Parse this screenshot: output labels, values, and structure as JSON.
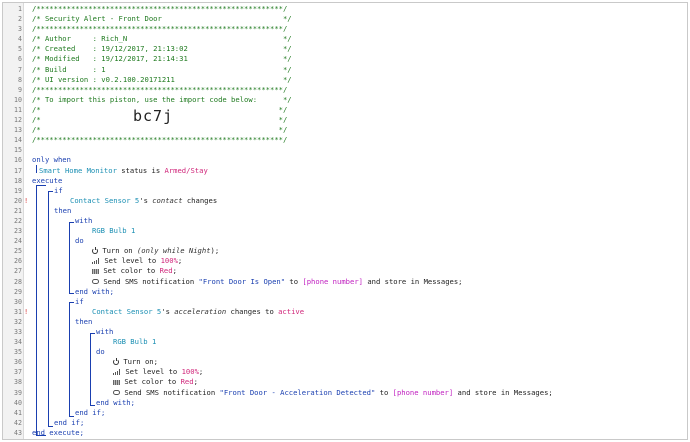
{
  "editor": {
    "lines": [
      {
        "n": "1",
        "t": "/*********************************************************/"
      },
      {
        "n": "2",
        "t": "/* Security Alert - Front Door                            */"
      },
      {
        "n": "3",
        "t": "/*********************************************************/"
      },
      {
        "n": "4",
        "t": "/* Author     : Rich_N                                    */"
      },
      {
        "n": "5",
        "t": "/* Created    : 19/12/2017, 21:13:02                      */"
      },
      {
        "n": "6",
        "t": "/* Modified   : 19/12/2017, 21:14:31                      */"
      },
      {
        "n": "7",
        "t": "/* Build      : 1                                         */"
      },
      {
        "n": "8",
        "t": "/* UI version : v0.2.100.20171211                         */"
      },
      {
        "n": "9",
        "t": "/*********************************************************/"
      },
      {
        "n": "10",
        "t": "/* To import this piston, use the import code below:      */"
      },
      {
        "n": "11",
        "t": "/*                                                       */"
      },
      {
        "n": "12",
        "t": "/*                                                       */"
      },
      {
        "n": "13",
        "t": "/*                                                       */"
      },
      {
        "n": "14",
        "t": "/*********************************************************/"
      },
      {
        "n": "15",
        "t": ""
      },
      {
        "n": "16",
        "t": ""
      },
      {
        "n": "17",
        "t": ""
      },
      {
        "n": "18",
        "t": ""
      },
      {
        "n": "19",
        "t": ""
      },
      {
        "n": "20",
        "t": ""
      },
      {
        "n": "21",
        "t": ""
      },
      {
        "n": "22",
        "t": ""
      },
      {
        "n": "23",
        "t": ""
      },
      {
        "n": "24",
        "t": ""
      },
      {
        "n": "25",
        "t": ""
      },
      {
        "n": "26",
        "t": ""
      },
      {
        "n": "27",
        "t": ""
      },
      {
        "n": "28",
        "t": ""
      },
      {
        "n": "29",
        "t": ""
      },
      {
        "n": "30",
        "t": ""
      },
      {
        "n": "31",
        "t": ""
      },
      {
        "n": "32",
        "t": ""
      },
      {
        "n": "33",
        "t": ""
      },
      {
        "n": "34",
        "t": ""
      },
      {
        "n": "35",
        "t": ""
      },
      {
        "n": "36",
        "t": ""
      },
      {
        "n": "37",
        "t": ""
      },
      {
        "n": "38",
        "t": ""
      },
      {
        "n": "39",
        "t": ""
      },
      {
        "n": "40",
        "t": ""
      },
      {
        "n": "41",
        "t": ""
      },
      {
        "n": "42",
        "t": ""
      },
      {
        "n": "43",
        "t": ""
      }
    ],
    "import_code": "bc7j",
    "warning_glyph": "!",
    "only_when": "only when",
    "smart_home_monitor": "Smart Home Monitor",
    "status_word": "status",
    "is_word": "is",
    "armed_stay": "Armed/Stay",
    "execute": "execute",
    "if": "if",
    "contact_sensor": "Contact Sensor 5",
    "possessive": "'s",
    "contact_attr": "contact",
    "changes": "changes",
    "then": "then",
    "with": "with",
    "rgb_bulb": "RGB Bulb 1",
    "do": "do",
    "turn_on": "Turn on",
    "only_while_open": "(only while",
    "night": "Night",
    "only_while_close": ");",
    "turn_on_plain": "Turn on;",
    "set_level_to": "Set level to",
    "level_value": "100%",
    "semicolon": ";",
    "set_color_to": "Set color to",
    "color_value": "Red",
    "send_sms": "Send SMS notification",
    "msg_open": "\"Front Door Is Open\"",
    "msg_accel": "\"Front Door - Acceleration Detected\"",
    "to": "to",
    "phone_number": "[phone number]",
    "store_in_messages": "and store in Messages;",
    "end_with": "end with;",
    "accel_attr": "acceleration",
    "changes_to": "changes to",
    "active": "active",
    "end_if": "end if;",
    "end_execute": "end execute;"
  }
}
